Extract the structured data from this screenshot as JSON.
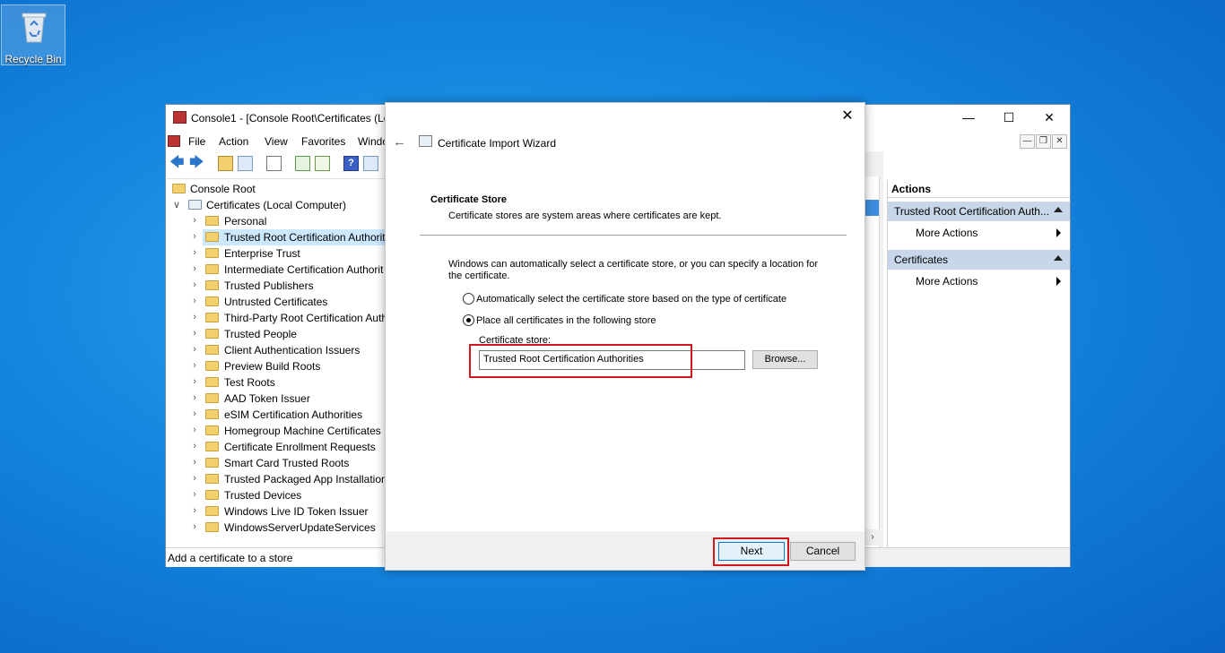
{
  "desktop": {
    "recycle_bin_label": "Recycle Bin"
  },
  "mmc": {
    "title": "Console1 - [Console Root\\Certificates (Lo",
    "menu": [
      "File",
      "Action",
      "View",
      "Favorites",
      "Windo"
    ],
    "tree": {
      "root": "Console Root",
      "certificates": "Certificates (Local Computer)",
      "items": [
        "Personal",
        "Trusted Root Certification Authorit",
        "Enterprise Trust",
        "Intermediate Certification Authorit",
        "Trusted Publishers",
        "Untrusted Certificates",
        "Third-Party Root Certification Auth",
        "Trusted People",
        "Client Authentication Issuers",
        "Preview Build Roots",
        "Test Roots",
        "AAD Token Issuer",
        "eSIM Certification Authorities",
        "Homegroup Machine Certificates",
        "Certificate Enrollment Requests",
        "Smart Card Trusted Roots",
        "Trusted Packaged App Installation",
        "Trusted Devices",
        "Windows Live ID Token Issuer",
        "WindowsServerUpdateServices"
      ],
      "selected_index": 1
    },
    "status": "Add a certificate to a store",
    "actions": {
      "header": "Actions",
      "group1": "Trusted Root Certification Auth...",
      "group1_item": "More Actions",
      "group2": "Certificates",
      "group2_item": "More Actions"
    }
  },
  "wizard": {
    "title": "Certificate Import Wizard",
    "section_title": "Certificate Store",
    "section_desc": "Certificate stores are system areas where certificates are kept.",
    "intro": "Windows can automatically select a certificate store, or you can specify a location for the certificate.",
    "option_auto": "Automatically select the certificate store based on the type of certificate",
    "option_manual": "Place all certificates in the following store",
    "selected_option": "manual",
    "store_label": "Certificate store:",
    "store_value": "Trusted Root Certification Authorities",
    "browse_label": "Browse...",
    "next_label": "Next",
    "cancel_label": "Cancel"
  },
  "colors": {
    "highlight": "#d0161e",
    "selection": "#cce8ff",
    "actions_group": "#c7d6e8"
  }
}
